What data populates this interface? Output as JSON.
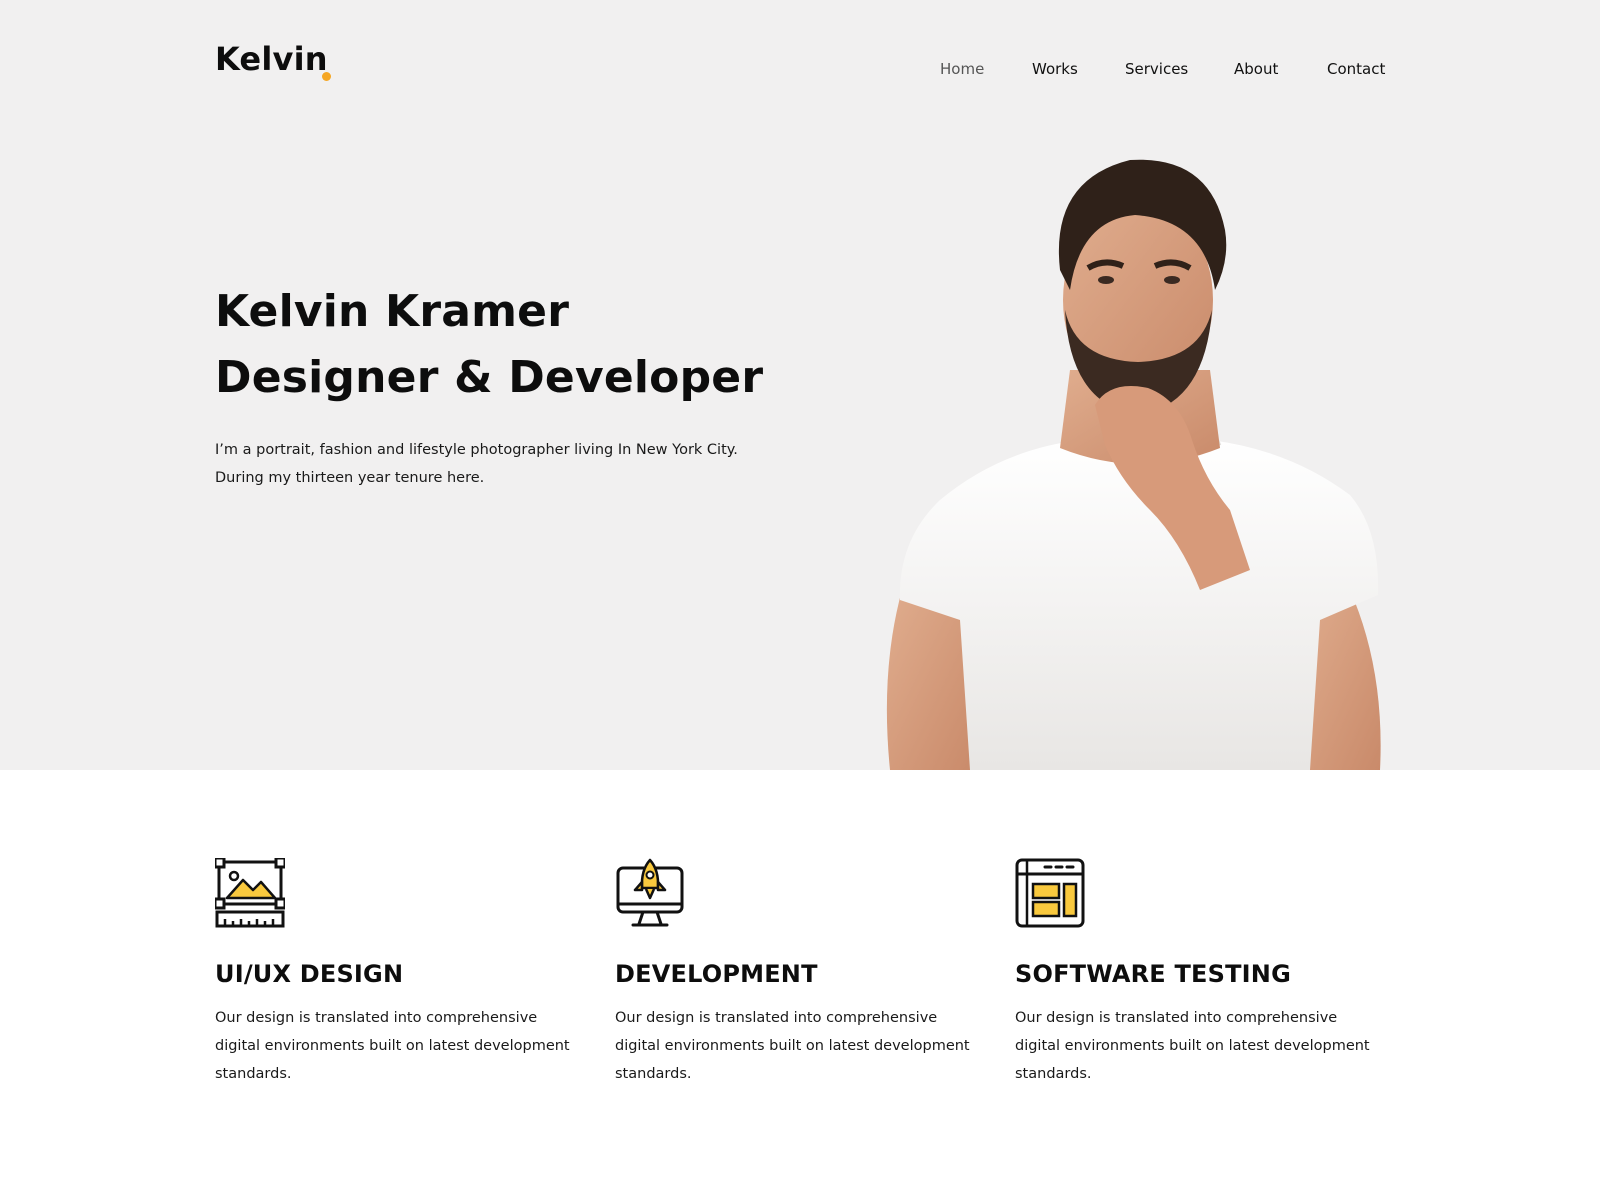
{
  "brand": {
    "name": "Kelvin",
    "accent": "#f5a623"
  },
  "nav": [
    {
      "label": "Home",
      "active": true
    },
    {
      "label": "Works",
      "active": false
    },
    {
      "label": "Services",
      "active": false
    },
    {
      "label": "About",
      "active": false
    },
    {
      "label": "Contact",
      "active": false
    }
  ],
  "hero": {
    "headline_line1": "Kelvin Kramer",
    "headline_line2": "Designer & Developer",
    "desc_line1": "I’m a portrait, fashion and lifestyle photographer living In New York City.",
    "desc_line2": "During my thirteen year tenure here."
  },
  "services": [
    {
      "icon": "image-ruler-icon",
      "title": "UI/UX DESIGN",
      "desc": "Our design is translated into comprehensive digital environments built on latest development standards."
    },
    {
      "icon": "monitor-rocket-icon",
      "title": "DEVELOPMENT",
      "desc": "Our design is translated into comprehensive digital environments built on latest development standards."
    },
    {
      "icon": "browser-layout-icon",
      "title": "SOFTWARE TESTING",
      "desc": "Our design is translated into comprehensive digital environments built on latest development standards."
    }
  ],
  "colors": {
    "hero_bg": "#f1f0f0",
    "icon_fill": "#f9c93e",
    "text": "#111111"
  }
}
